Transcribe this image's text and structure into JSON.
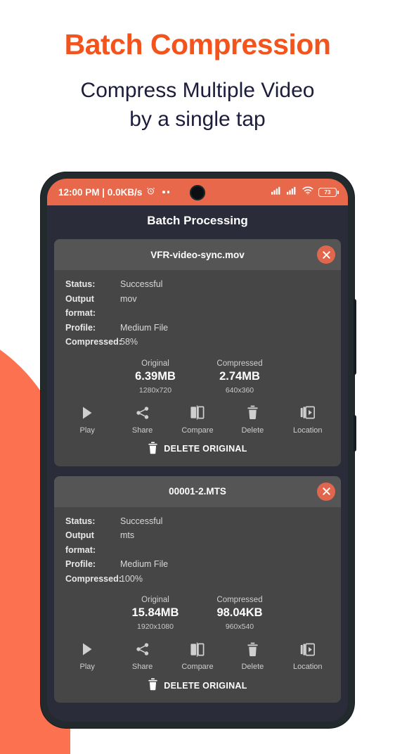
{
  "promo": {
    "headline": "Batch Compression",
    "subline_line1": "Compress Multiple Video",
    "subline_line2": "by a single tap",
    "headline_color": "#f4531c",
    "subline_color": "#1c1c3c",
    "accent_color": "#fc7150"
  },
  "phone": {
    "statusbar": {
      "time_and_speed": "12:00 PM | 0.0KB/s",
      "alarm_icon": "alarm-icon",
      "overflow_dots": "more-dots-icon",
      "signal_1_icon": "signal-bars-icon",
      "signal_2_icon": "signal-bars-icon",
      "wifi_icon": "wifi-icon",
      "battery_level": "73",
      "background_color": "#e8684c"
    },
    "app_title": "Batch Processing"
  },
  "cards": [
    {
      "filename": "VFR-video-sync.mov",
      "close_icon": "close-circle-icon",
      "details": [
        {
          "key": "Status:",
          "value": "Successful"
        },
        {
          "key": "Output format:",
          "value": "mov"
        },
        {
          "key": "Profile:",
          "value": "Medium File"
        },
        {
          "key": "Compressed:",
          "value": "58%"
        }
      ],
      "original": {
        "label": "Original",
        "size": "6.39MB",
        "dimensions": "1280x720"
      },
      "compressed": {
        "label": "Compressed",
        "size": "2.74MB",
        "dimensions": "640x360"
      },
      "actions": [
        {
          "label": "Play",
          "icon": "play-icon"
        },
        {
          "label": "Share",
          "icon": "share-icon"
        },
        {
          "label": "Compare",
          "icon": "compare-icon"
        },
        {
          "label": "Delete",
          "icon": "trash-icon"
        },
        {
          "label": "Location",
          "icon": "video-library-icon"
        }
      ],
      "delete_original": {
        "label": "DELETE ORIGINAL",
        "icon": "trash-icon"
      }
    },
    {
      "filename": "00001-2.MTS",
      "close_icon": "close-circle-icon",
      "details": [
        {
          "key": "Status:",
          "value": "Successful"
        },
        {
          "key": "Output format:",
          "value": "mts"
        },
        {
          "key": "Profile:",
          "value": "Medium File"
        },
        {
          "key": "Compressed:",
          "value": "100%"
        }
      ],
      "original": {
        "label": "Original",
        "size": "15.84MB",
        "dimensions": "1920x1080"
      },
      "compressed": {
        "label": "Compressed",
        "size": "98.04KB",
        "dimensions": "960x540"
      },
      "actions": [
        {
          "label": "Play",
          "icon": "play-icon"
        },
        {
          "label": "Share",
          "icon": "share-icon"
        },
        {
          "label": "Compare",
          "icon": "compare-icon"
        },
        {
          "label": "Delete",
          "icon": "trash-icon"
        },
        {
          "label": "Location",
          "icon": "video-library-icon"
        }
      ],
      "delete_original": {
        "label": "DELETE ORIGINAL",
        "icon": "trash-icon"
      }
    }
  ]
}
